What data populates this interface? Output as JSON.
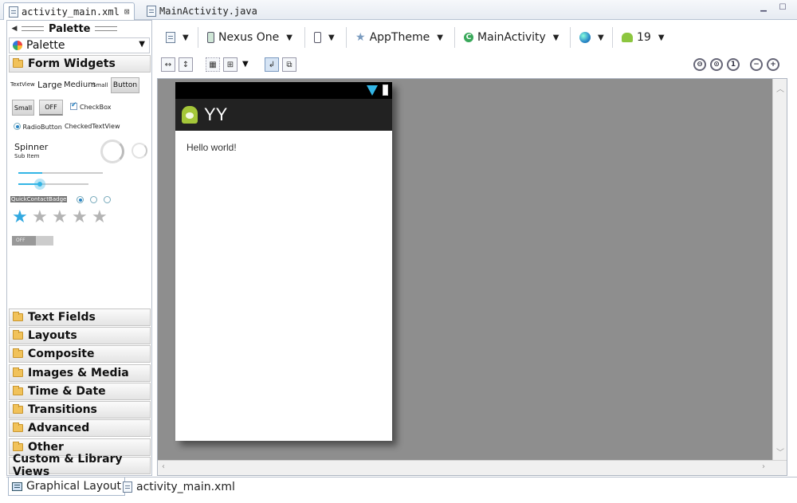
{
  "tabs": [
    {
      "label": "activity_main.xml",
      "close": "⊠",
      "active": true
    },
    {
      "label": "MainActivity.java",
      "active": false
    }
  ],
  "palette": {
    "title": "Palette",
    "dropdown": "Palette",
    "open_category": "Form Widgets",
    "widgets": {
      "textview": "TextView",
      "large": "Large",
      "medium": "Medium",
      "small": "Small",
      "button": "Button",
      "small_button": "Small",
      "toggle_off": "OFF",
      "checkbox": "CheckBox",
      "radiobutton": "RadioButton",
      "checked_textview": "CheckedTextView",
      "spinner": "Spinner",
      "spinner_sub": "Sub Item",
      "quick_contact": "QuickContactBadge",
      "switch_off": "OFF",
      "rating_value": 1,
      "rating_max": 5
    },
    "categories": [
      "Text Fields",
      "Layouts",
      "Composite",
      "Images & Media",
      "Time & Date",
      "Transitions",
      "Advanced",
      "Other",
      "Custom & Library Views"
    ]
  },
  "toolbar": {
    "device": "Nexus One",
    "theme": "AppTheme",
    "activity": "MainActivity",
    "api_level": "19"
  },
  "preview": {
    "app_title": "YY",
    "hello_text": "Hello world!"
  },
  "bottom_tabs": [
    {
      "label": "Graphical Layout",
      "active": true
    },
    {
      "label": "activity_main.xml",
      "active": false
    }
  ],
  "colors": {
    "canvas_bg": "#8e8e8e",
    "action_bar": "#222222",
    "accent_blue": "#33b5e5",
    "android_green": "#a4c639"
  }
}
